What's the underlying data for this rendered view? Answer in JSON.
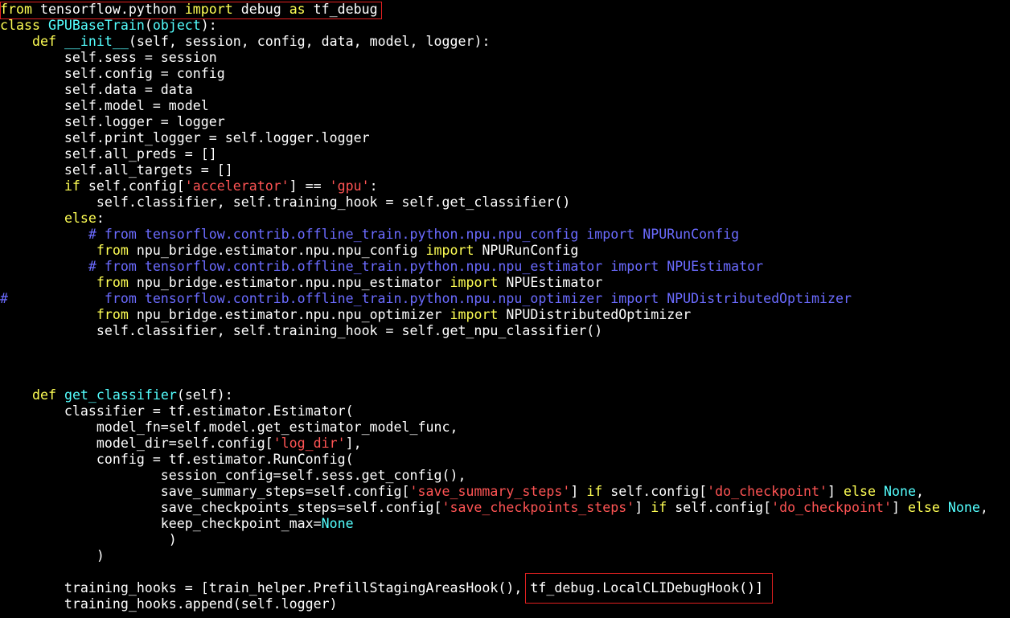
{
  "colors": {
    "background": "#000000",
    "plain": "#ffffff",
    "keyword": "#ffff54",
    "classname": "#54ffff",
    "string": "#ff5454",
    "comment": "#6b6bff",
    "constant": "#54ffff",
    "highlight_box": "#e02020"
  },
  "lines": [
    {
      "id": "l1",
      "tokens": [
        {
          "t": "keyword",
          "v": "from"
        },
        {
          "t": "plain",
          "v": " tensorflow.python "
        },
        {
          "t": "keyword",
          "v": "import"
        },
        {
          "t": "plain",
          "v": " debug "
        },
        {
          "t": "keyword",
          "v": "as"
        },
        {
          "t": "plain",
          "v": " tf_debug"
        }
      ]
    },
    {
      "id": "l2",
      "tokens": [
        {
          "t": "keyword",
          "v": "class"
        },
        {
          "t": "plain",
          "v": " "
        },
        {
          "t": "classname",
          "v": "GPUBaseTrain"
        },
        {
          "t": "plain",
          "v": "("
        },
        {
          "t": "classname",
          "v": "object"
        },
        {
          "t": "plain",
          "v": "):"
        }
      ]
    },
    {
      "id": "l3",
      "tokens": [
        {
          "t": "plain",
          "v": "    "
        },
        {
          "t": "keyword",
          "v": "def"
        },
        {
          "t": "plain",
          "v": " "
        },
        {
          "t": "classname",
          "v": "__init__"
        },
        {
          "t": "plain",
          "v": "(self, session, config, data, model, logger):"
        }
      ]
    },
    {
      "id": "l4",
      "tokens": [
        {
          "t": "plain",
          "v": "        self.sess = session"
        }
      ]
    },
    {
      "id": "l5",
      "tokens": [
        {
          "t": "plain",
          "v": "        self.config = config"
        }
      ]
    },
    {
      "id": "l6",
      "tokens": [
        {
          "t": "plain",
          "v": "        self.data = data"
        }
      ]
    },
    {
      "id": "l7",
      "tokens": [
        {
          "t": "plain",
          "v": "        self.model = model"
        }
      ]
    },
    {
      "id": "l8",
      "tokens": [
        {
          "t": "plain",
          "v": "        self.logger = logger"
        }
      ]
    },
    {
      "id": "l9",
      "tokens": [
        {
          "t": "plain",
          "v": "        self.print_logger = self.logger.logger"
        }
      ]
    },
    {
      "id": "l10",
      "tokens": [
        {
          "t": "plain",
          "v": "        self.all_preds = []"
        }
      ]
    },
    {
      "id": "l11",
      "tokens": [
        {
          "t": "plain",
          "v": "        self.all_targets = []"
        }
      ]
    },
    {
      "id": "l12",
      "tokens": [
        {
          "t": "plain",
          "v": "        "
        },
        {
          "t": "keyword",
          "v": "if"
        },
        {
          "t": "plain",
          "v": " self.config["
        },
        {
          "t": "string",
          "v": "'accelerator'"
        },
        {
          "t": "plain",
          "v": "] == "
        },
        {
          "t": "string",
          "v": "'gpu'"
        },
        {
          "t": "plain",
          "v": ":"
        }
      ]
    },
    {
      "id": "l13",
      "tokens": [
        {
          "t": "plain",
          "v": "            self.classifier, self.training_hook = self.get_classifier()"
        }
      ]
    },
    {
      "id": "l14",
      "tokens": [
        {
          "t": "plain",
          "v": "        "
        },
        {
          "t": "keyword",
          "v": "else"
        },
        {
          "t": "plain",
          "v": ":"
        }
      ]
    },
    {
      "id": "l15",
      "tokens": [
        {
          "t": "plain",
          "v": "           "
        },
        {
          "t": "comment",
          "v": "# from tensorflow.contrib.offline_train.python.npu.npu_config import NPURunConfig"
        }
      ]
    },
    {
      "id": "l16",
      "tokens": [
        {
          "t": "plain",
          "v": "            "
        },
        {
          "t": "keyword",
          "v": "from"
        },
        {
          "t": "plain",
          "v": " npu_bridge.estimator.npu.npu_config "
        },
        {
          "t": "keyword",
          "v": "import"
        },
        {
          "t": "plain",
          "v": " NPURunConfig"
        }
      ]
    },
    {
      "id": "l17",
      "tokens": [
        {
          "t": "plain",
          "v": "           "
        },
        {
          "t": "comment",
          "v": "# from tensorflow.contrib.offline_train.python.npu.npu_estimator import NPUEstimator"
        }
      ]
    },
    {
      "id": "l18",
      "tokens": [
        {
          "t": "plain",
          "v": "            "
        },
        {
          "t": "keyword",
          "v": "from"
        },
        {
          "t": "plain",
          "v": " npu_bridge.estimator.npu.npu_estimator "
        },
        {
          "t": "keyword",
          "v": "import"
        },
        {
          "t": "plain",
          "v": " NPUEstimator"
        }
      ]
    },
    {
      "id": "l19",
      "tokens": [
        {
          "t": "comment",
          "v": "#            from tensorflow.contrib.offline_train.python.npu.npu_optimizer import NPUDistributedOptimizer"
        }
      ]
    },
    {
      "id": "l20",
      "tokens": [
        {
          "t": "plain",
          "v": "            "
        },
        {
          "t": "keyword",
          "v": "from"
        },
        {
          "t": "plain",
          "v": " npu_bridge.estimator.npu.npu_optimizer "
        },
        {
          "t": "keyword",
          "v": "import"
        },
        {
          "t": "plain",
          "v": " NPUDistributedOptimizer"
        }
      ]
    },
    {
      "id": "l21",
      "tokens": [
        {
          "t": "plain",
          "v": "            self.classifier, self.training_hook = self.get_npu_classifier()"
        }
      ]
    },
    {
      "id": "l22",
      "tokens": []
    },
    {
      "id": "l23",
      "tokens": []
    },
    {
      "id": "l24",
      "tokens": []
    },
    {
      "id": "l25",
      "tokens": [
        {
          "t": "plain",
          "v": "    "
        },
        {
          "t": "keyword",
          "v": "def"
        },
        {
          "t": "plain",
          "v": " "
        },
        {
          "t": "classname",
          "v": "get_classifier"
        },
        {
          "t": "plain",
          "v": "(self):"
        }
      ]
    },
    {
      "id": "l26",
      "tokens": [
        {
          "t": "plain",
          "v": "        classifier = tf.estimator.Estimator("
        }
      ]
    },
    {
      "id": "l27",
      "tokens": [
        {
          "t": "plain",
          "v": "            model_fn=self.model.get_estimator_model_func,"
        }
      ]
    },
    {
      "id": "l28",
      "tokens": [
        {
          "t": "plain",
          "v": "            model_dir=self.config["
        },
        {
          "t": "string",
          "v": "'log_dir'"
        },
        {
          "t": "plain",
          "v": "],"
        }
      ]
    },
    {
      "id": "l29",
      "tokens": [
        {
          "t": "plain",
          "v": "            config = tf.estimator.RunConfig("
        }
      ]
    },
    {
      "id": "l30",
      "tokens": [
        {
          "t": "plain",
          "v": "                    session_config=self.sess.get_config(),"
        }
      ]
    },
    {
      "id": "l31",
      "tokens": [
        {
          "t": "plain",
          "v": "                    save_summary_steps=self.config["
        },
        {
          "t": "string",
          "v": "'save_summary_steps'"
        },
        {
          "t": "plain",
          "v": "] "
        },
        {
          "t": "keyword",
          "v": "if"
        },
        {
          "t": "plain",
          "v": " self.config["
        },
        {
          "t": "string",
          "v": "'do_checkpoint'"
        },
        {
          "t": "plain",
          "v": "] "
        },
        {
          "t": "keyword",
          "v": "else"
        },
        {
          "t": "plain",
          "v": " "
        },
        {
          "t": "const",
          "v": "None"
        },
        {
          "t": "plain",
          "v": ","
        }
      ]
    },
    {
      "id": "l32",
      "tokens": [
        {
          "t": "plain",
          "v": "                    save_checkpoints_steps=self.config["
        },
        {
          "t": "string",
          "v": "'save_checkpoints_steps'"
        },
        {
          "t": "plain",
          "v": "] "
        },
        {
          "t": "keyword",
          "v": "if"
        },
        {
          "t": "plain",
          "v": " self.config["
        },
        {
          "t": "string",
          "v": "'do_checkpoint'"
        },
        {
          "t": "plain",
          "v": "] "
        },
        {
          "t": "keyword",
          "v": "else"
        },
        {
          "t": "plain",
          "v": " "
        },
        {
          "t": "const",
          "v": "None"
        },
        {
          "t": "plain",
          "v": ","
        }
      ]
    },
    {
      "id": "l33",
      "tokens": [
        {
          "t": "plain",
          "v": "                    keep_checkpoint_max="
        },
        {
          "t": "const",
          "v": "None"
        }
      ]
    },
    {
      "id": "l34",
      "tokens": [
        {
          "t": "plain",
          "v": "                     )"
        }
      ]
    },
    {
      "id": "l35",
      "tokens": [
        {
          "t": "plain",
          "v": "            )"
        }
      ]
    },
    {
      "id": "l36",
      "tokens": []
    },
    {
      "id": "l37",
      "tokens": [
        {
          "t": "plain",
          "v": "        training_hooks = [train_helper.PrefillStagingAreasHook(), tf_debug.LocalCLIDebugHook()]"
        }
      ]
    },
    {
      "id": "l38",
      "tokens": [
        {
          "t": "plain",
          "v": "        training_hooks.append(self.logger)"
        }
      ]
    }
  ]
}
